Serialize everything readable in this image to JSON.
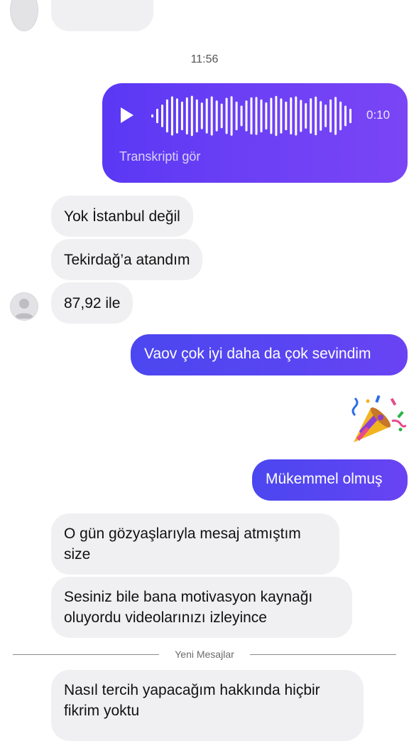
{
  "timestamp": "11:56",
  "voice_message": {
    "duration": "0:10",
    "transcript_link": "Transkripti gör",
    "play_icon": "play-icon"
  },
  "messages": [
    {
      "from": "them",
      "text": "Yok İstanbul değil"
    },
    {
      "from": "them",
      "text": "Tekirdağ’a atandım"
    },
    {
      "from": "them",
      "text": "87,92 ile"
    },
    {
      "from": "me",
      "text": "Vaov çok iyi daha da çok sevindim"
    },
    {
      "from": "me",
      "text": "🎉",
      "kind": "party-popper-emoji"
    },
    {
      "from": "me",
      "text": "Mükemmel olmuş"
    },
    {
      "from": "them",
      "text": "O gün gözyaşlarıyla mesaj atmıştım size"
    },
    {
      "from": "them",
      "text": "Sesiniz bile bana motivasyon kaynağı oluyordu videolarınızı izleyince"
    },
    {
      "from": "them",
      "text": "Nasıl tercih yapacağım hakkında hiçbir fikrim yoktu"
    }
  ],
  "divider_label": "Yeni Mesajlar",
  "colors": {
    "outgoing_bubble": "#4f46f0",
    "voice_bubble": "#6b3ff5",
    "incoming_bubble": "#f0f0f2"
  }
}
